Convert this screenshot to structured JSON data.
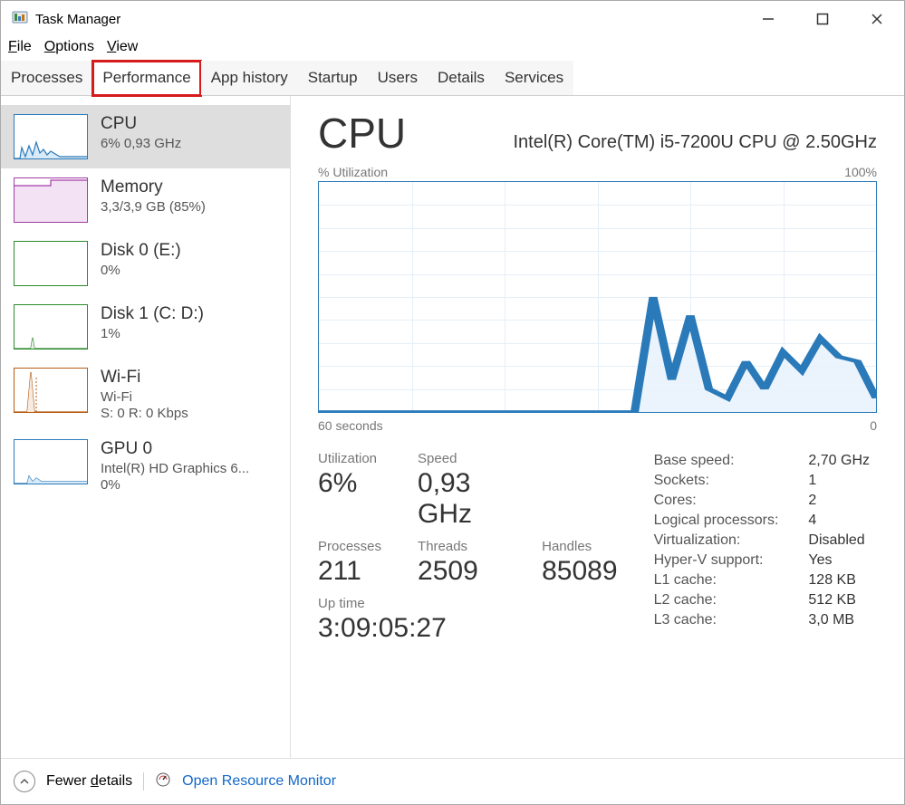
{
  "title": "Task Manager",
  "menu": [
    "File",
    "Options",
    "View"
  ],
  "tabs": [
    "Processes",
    "Performance",
    "App history",
    "Startup",
    "Users",
    "Details",
    "Services"
  ],
  "active_tab": 1,
  "highlight_tab": 1,
  "sidebar": [
    {
      "name": "CPU",
      "line2": "6%  0,93 GHz",
      "line3": "",
      "thumbColor": "#2a7ab9",
      "thumbKey": "cpu"
    },
    {
      "name": "Memory",
      "line2": "3,3/3,9 GB (85%)",
      "line3": "",
      "thumbColor": "#a23ca5",
      "thumbKey": "mem"
    },
    {
      "name": "Disk 0 (E:)",
      "line2": "0%",
      "line3": "",
      "thumbColor": "#2e8a2e",
      "thumbKey": "disk0"
    },
    {
      "name": "Disk 1 (C: D:)",
      "line2": "1%",
      "line3": "",
      "thumbColor": "#2e8a2e",
      "thumbKey": "disk1"
    },
    {
      "name": "Wi-Fi",
      "line2": "Wi-Fi",
      "line3": "S: 0  R: 0 Kbps",
      "thumbColor": "#b65a11",
      "thumbKey": "wifi"
    },
    {
      "name": "GPU 0",
      "line2": "Intel(R) HD Graphics 6...",
      "line3": "0%",
      "thumbColor": "#2a7ab9",
      "thumbKey": "gpu"
    }
  ],
  "selected_sidebar": 0,
  "main": {
    "title": "CPU",
    "subtitle": "Intel(R) Core(TM) i5-7200U CPU @ 2.50GHz",
    "chart_top_left": "% Utilization",
    "chart_top_right": "100%",
    "chart_bottom_left": "60 seconds",
    "chart_bottom_right": "0",
    "stats_left": [
      {
        "label": "Utilization",
        "value": "6%"
      },
      {
        "label": "Speed",
        "value": "0,93 GHz"
      },
      {
        "label": "",
        "value": ""
      },
      {
        "label": "Processes",
        "value": "211"
      },
      {
        "label": "Threads",
        "value": "2509"
      },
      {
        "label": "Handles",
        "value": "85089"
      }
    ],
    "uptime_label": "Up time",
    "uptime_value": "3:09:05:27",
    "stats_right": [
      [
        "Base speed:",
        "2,70 GHz"
      ],
      [
        "Sockets:",
        "1"
      ],
      [
        "Cores:",
        "2"
      ],
      [
        "Logical processors:",
        "4"
      ],
      [
        "Virtualization:",
        "Disabled"
      ],
      [
        "Hyper-V support:",
        "Yes"
      ],
      [
        "L1 cache:",
        "128 KB"
      ],
      [
        "L2 cache:",
        "512 KB"
      ],
      [
        "L3 cache:",
        "3,0 MB"
      ]
    ]
  },
  "footer": {
    "fewer_details": "Fewer details",
    "open_monitor": "Open Resource Monitor"
  },
  "chart_data": {
    "type": "line",
    "title": "CPU % Utilization",
    "xlabel": "seconds",
    "ylabel": "% Utilization",
    "ylim": [
      0,
      100
    ],
    "xlim": [
      60,
      0
    ],
    "x": [
      60,
      58,
      56,
      54,
      52,
      50,
      48,
      46,
      44,
      42,
      40,
      38,
      36,
      34,
      32,
      30,
      28,
      26,
      24,
      22,
      20,
      18,
      16,
      14,
      12,
      10,
      8,
      6,
      4,
      2,
      0
    ],
    "values": [
      0,
      0,
      0,
      0,
      0,
      0,
      0,
      0,
      0,
      0,
      0,
      0,
      0,
      0,
      0,
      0,
      0,
      0,
      50,
      14,
      42,
      10,
      6,
      22,
      10,
      26,
      18,
      32,
      24,
      22,
      6
    ]
  }
}
